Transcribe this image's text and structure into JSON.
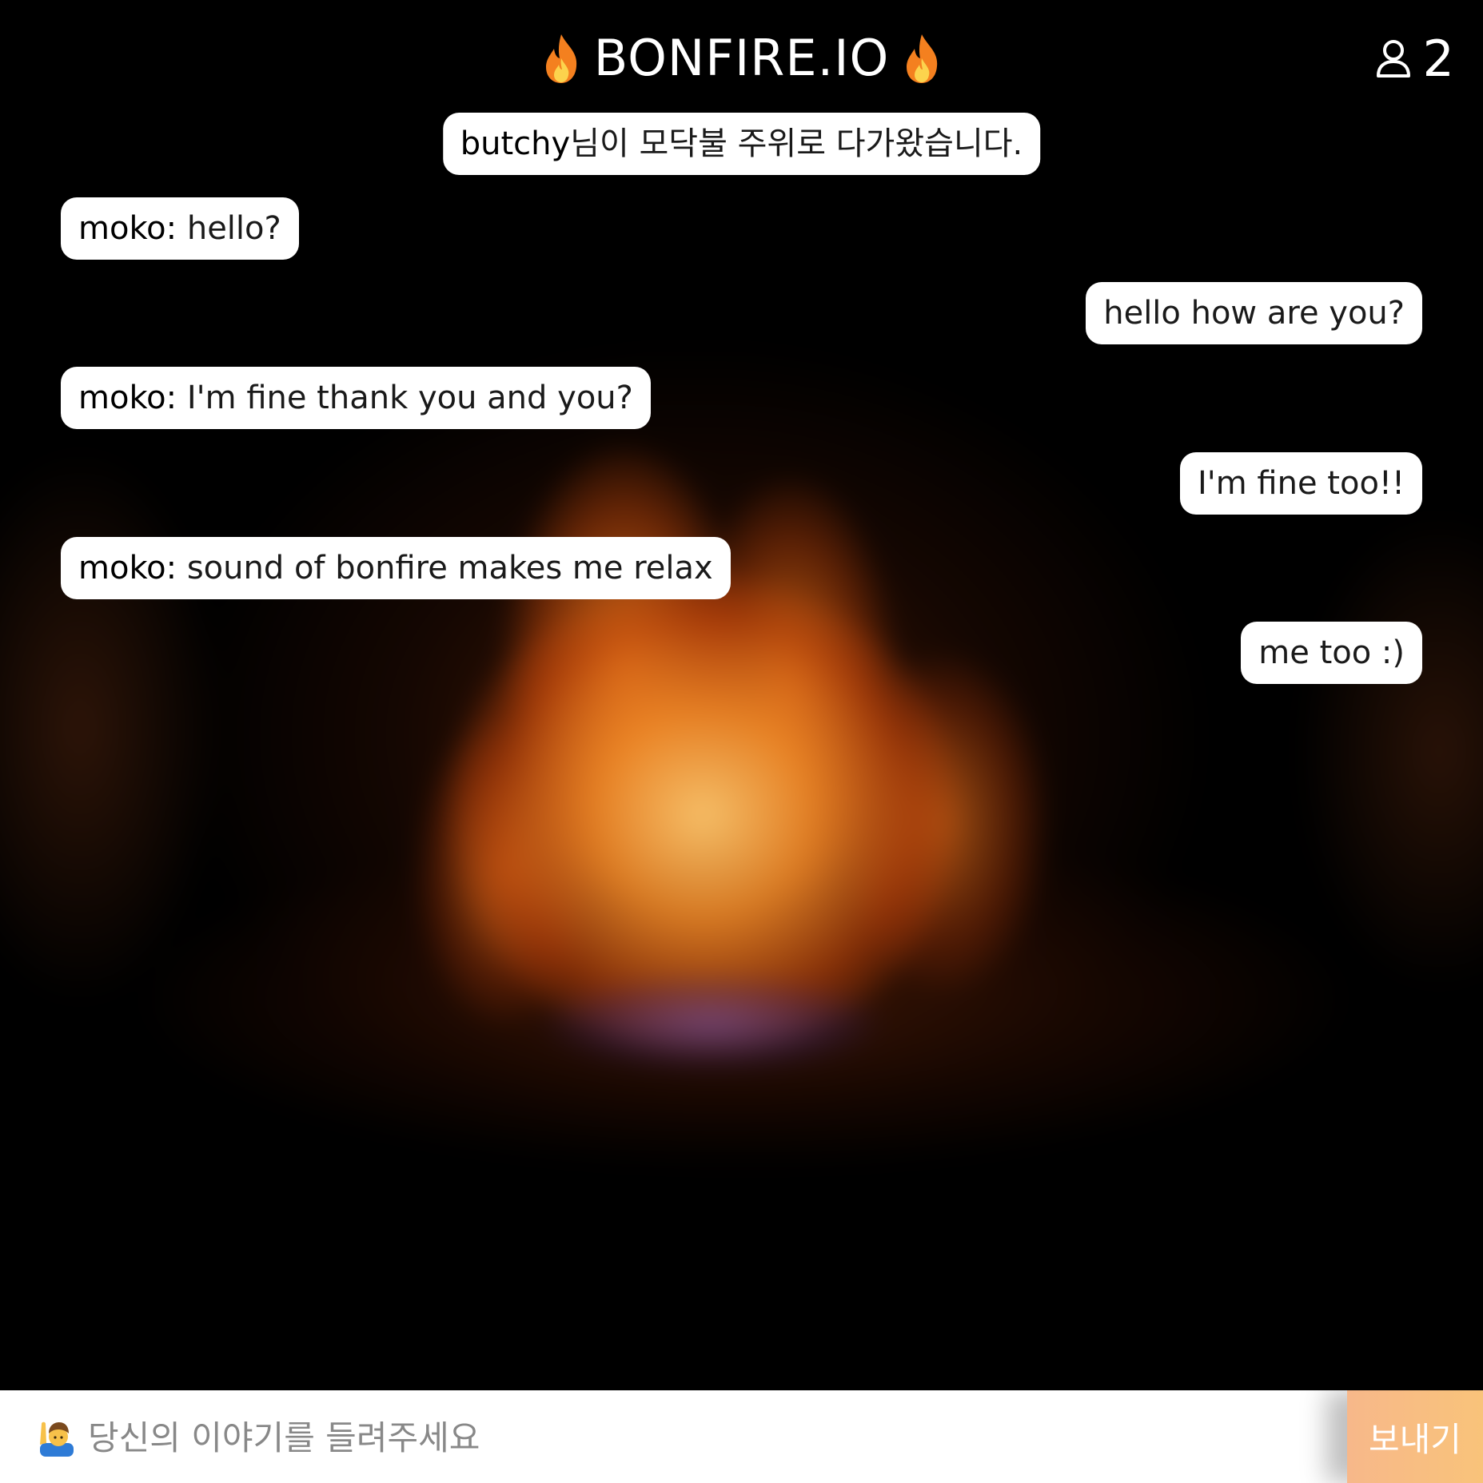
{
  "header": {
    "title": "BONFIRE.IO",
    "flame_icon": "fire-emoji-icon",
    "user_icon": "user-outline-icon",
    "user_count": "2"
  },
  "system_message": {
    "user": "butchy",
    "text": "님이 모닥불 주위로 다가왔습니다."
  },
  "messages": [
    {
      "side": "left",
      "author": "moko:",
      "text": " hello?"
    },
    {
      "side": "right",
      "author": "",
      "text": "hello how are you?"
    },
    {
      "side": "left",
      "author": "moko:",
      "text": " I'm fine thank you and you?"
    },
    {
      "side": "right",
      "author": "",
      "text": "I'm fine too!!"
    },
    {
      "side": "left",
      "author": "moko:",
      "text": " sound of bonfire makes me relax"
    },
    {
      "side": "right",
      "author": "",
      "text": "me too :)"
    }
  ],
  "composer": {
    "icon": "person-raising-hand-icon",
    "placeholder": "당신의 이야기를 들려주세요",
    "value": "",
    "send_label": "보내기"
  },
  "colors": {
    "background": "#000000",
    "bubble": "#ffffff",
    "send_gradient_start": "#f7b88a",
    "send_gradient_end": "#f9c37a"
  }
}
